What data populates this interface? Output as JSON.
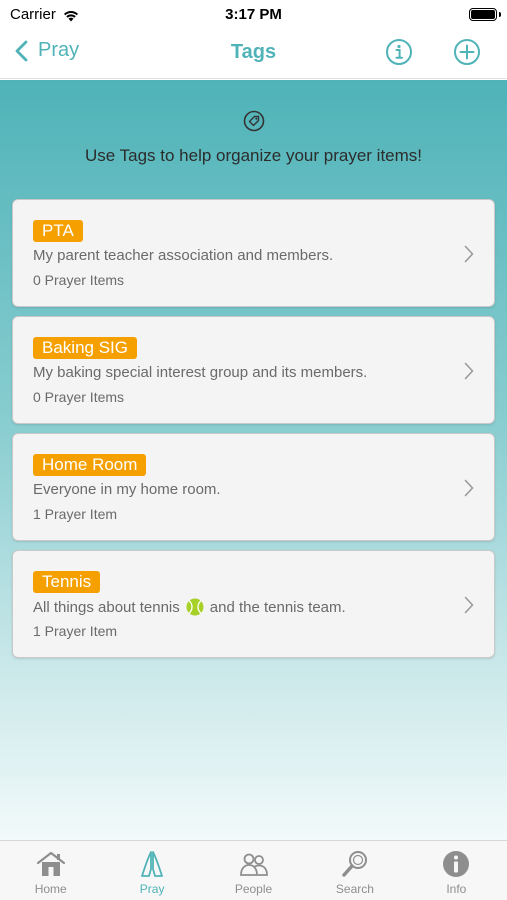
{
  "status_bar": {
    "carrier": "Carrier",
    "time": "3:17 PM"
  },
  "nav": {
    "back_label": "Pray",
    "title": "Tags"
  },
  "intro": {
    "text": "Use Tags to help organize your prayer items!"
  },
  "tags": [
    {
      "name": "PTA",
      "description": "My parent teacher association and members.",
      "count": "0 Prayer Items"
    },
    {
      "name": "Baking SIG",
      "description": "My baking special interest group and its members.",
      "count": "0 Prayer Items"
    },
    {
      "name": "Home Room",
      "description": "Everyone in my home room.",
      "count": "1 Prayer Item"
    },
    {
      "name": "Tennis",
      "description_before": "All things about tennis",
      "description_after": "and the tennis team.",
      "count": "1 Prayer Item"
    }
  ],
  "tab_bar": {
    "items": [
      {
        "label": "Home",
        "icon": "home-icon"
      },
      {
        "label": "Pray",
        "icon": "praying-hands-icon",
        "active": true
      },
      {
        "label": "People",
        "icon": "people-icon"
      },
      {
        "label": "Search",
        "icon": "search-icon"
      },
      {
        "label": "Info",
        "icon": "info-icon"
      }
    ]
  },
  "colors": {
    "accent": "#4fb3b8",
    "tag_badge": "#f6a000",
    "inactive_tab": "#8e8e8e"
  }
}
